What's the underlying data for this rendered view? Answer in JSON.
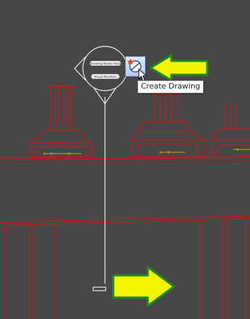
{
  "view": {
    "background": "#474747",
    "line_color": "#e01010",
    "annotation_color": "#c9b400"
  },
  "callout": {
    "pill_top_label": "Drawing Name Here",
    "pill_bottom_label": "Sheet Number"
  },
  "command": {
    "icon": "create-drawing-icon",
    "tooltip": "Create Drawing"
  },
  "arrows": {
    "color": "#f5f500",
    "border": "#1f8a1f"
  }
}
